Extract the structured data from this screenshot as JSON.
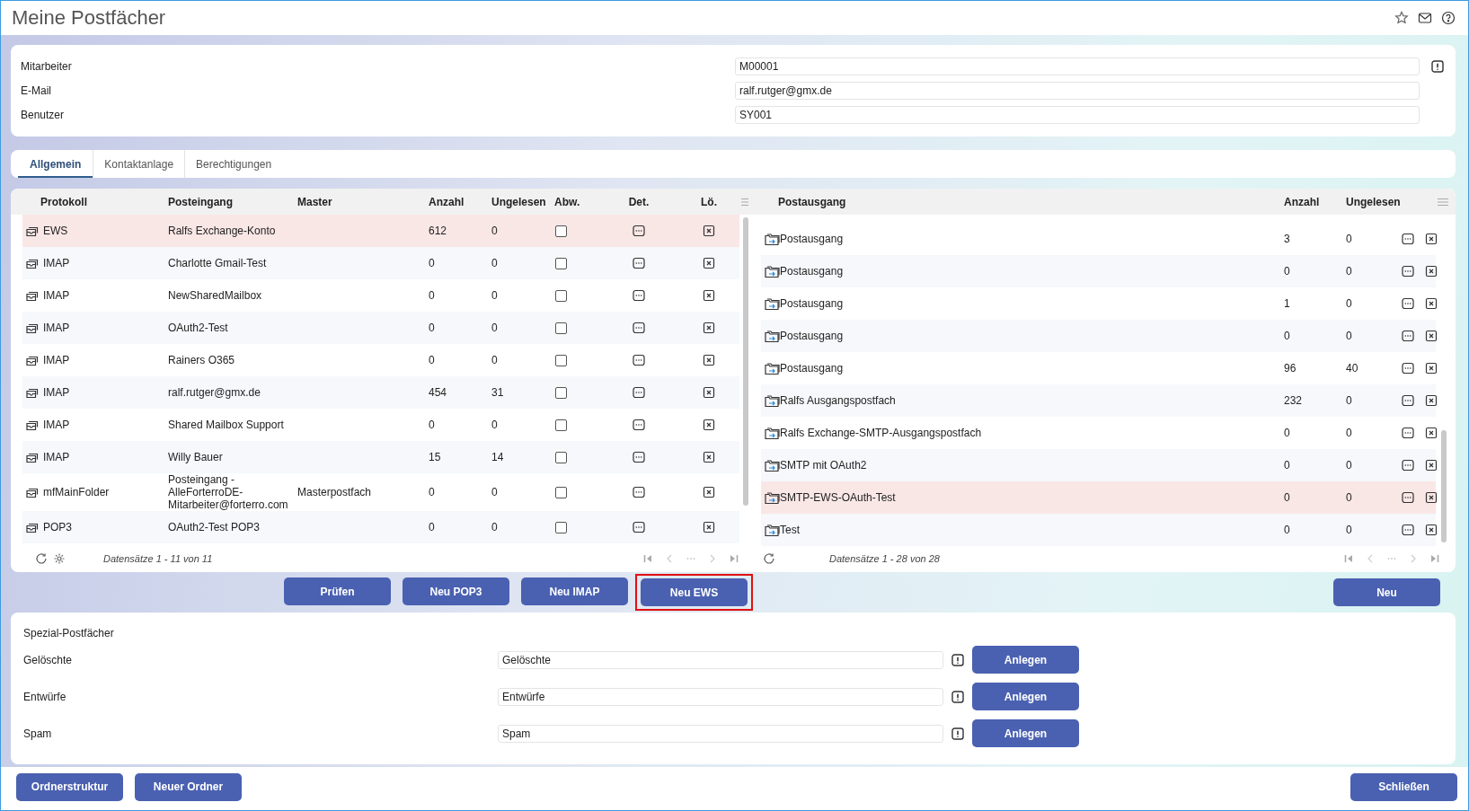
{
  "page": {
    "title": "Meine Postfächer"
  },
  "header_fields": [
    {
      "label": "Mitarbeiter",
      "value": "M00001",
      "alert": true
    },
    {
      "label": "E-Mail",
      "value": "ralf.rutger@gmx.de",
      "alert": false
    },
    {
      "label": "Benutzer",
      "value": "SY001",
      "alert": false
    }
  ],
  "tabs": [
    {
      "label": "Allgemein",
      "selected": true
    },
    {
      "label": "Kontaktanlage",
      "selected": false
    },
    {
      "label": "Berechtigungen",
      "selected": false
    }
  ],
  "inbox_table": {
    "columns": [
      "Protokoll",
      "Posteingang",
      "Master",
      "Anzahl",
      "Ungelesen",
      "Abw.",
      "Det.",
      "Lö."
    ],
    "rows": [
      {
        "protocol": "EWS",
        "name": "Ralfs Exchange-Konto",
        "count": "612",
        "unread": "0",
        "checked": false,
        "selected": true
      },
      {
        "protocol": "IMAP",
        "name": "Charlotte Gmail-Test",
        "count": "0",
        "unread": "0",
        "checked": false,
        "selected": false
      },
      {
        "protocol": "IMAP",
        "name": "NewSharedMailbox",
        "count": "0",
        "unread": "0",
        "checked": false,
        "selected": false
      },
      {
        "protocol": "IMAP",
        "name": "OAuth2-Test",
        "count": "0",
        "unread": "0",
        "checked": false,
        "selected": false
      },
      {
        "protocol": "IMAP",
        "name": "Rainers O365",
        "count": "0",
        "unread": "0",
        "checked": false,
        "selected": false
      },
      {
        "protocol": "IMAP",
        "name": "ralf.rutger@gmx.de",
        "count": "454",
        "unread": "31",
        "checked": false,
        "selected": false
      },
      {
        "protocol": "IMAP",
        "name": "Shared Mailbox Support",
        "count": "0",
        "unread": "0",
        "checked": false,
        "selected": false
      },
      {
        "protocol": "IMAP",
        "name": "Willy Bauer",
        "count": "15",
        "unread": "14",
        "checked": false,
        "selected": false
      },
      {
        "protocol": "mfMainFolder",
        "name": "Posteingang - AlleForterroDE-Mitarbeiter@forterro.com",
        "master": "Masterpostfach",
        "count": "0",
        "unread": "0",
        "checked": false,
        "selected": false
      },
      {
        "protocol": "POP3",
        "name": "OAuth2-Test POP3",
        "count": "0",
        "unread": "0",
        "checked": false,
        "selected": false
      }
    ],
    "footer": "Datensätze 1 - 11 von 11"
  },
  "outbox_table": {
    "columns": [
      "Postausgang",
      "Anzahl",
      "Ungelesen"
    ],
    "rows": [
      {
        "name": "Postausgang",
        "count": "3",
        "unread": "0",
        "selected": false
      },
      {
        "name": "Postausgang",
        "count": "0",
        "unread": "0",
        "selected": false
      },
      {
        "name": "Postausgang",
        "count": "1",
        "unread": "0",
        "selected": false
      },
      {
        "name": "Postausgang",
        "count": "0",
        "unread": "0",
        "selected": false
      },
      {
        "name": "Postausgang",
        "count": "96",
        "unread": "40",
        "selected": false
      },
      {
        "name": "Ralfs Ausgangspostfach",
        "count": "232",
        "unread": "0",
        "selected": false
      },
      {
        "name": "Ralfs Exchange-SMTP-Ausgangspostfach",
        "count": "0",
        "unread": "0",
        "selected": false
      },
      {
        "name": "SMTP mit OAuth2",
        "count": "0",
        "unread": "0",
        "selected": false
      },
      {
        "name": "SMTP-EWS-OAuth-Test",
        "count": "0",
        "unread": "0",
        "selected": true
      },
      {
        "name": "Test",
        "count": "0",
        "unread": "0",
        "selected": false
      }
    ],
    "footer": "Datensätze 1 - 28 von 28"
  },
  "inbox_buttons": [
    {
      "label": "Prüfen",
      "highlighted": false
    },
    {
      "label": "Neu POP3",
      "highlighted": false
    },
    {
      "label": "Neu IMAP",
      "highlighted": false
    },
    {
      "label": "Neu EWS",
      "highlighted": true
    }
  ],
  "outbox_buttons": [
    {
      "label": "Neu",
      "highlighted": false
    }
  ],
  "special": {
    "title": "Spezial-Postfächer",
    "rows": [
      {
        "label": "Gelöschte",
        "value": "Gelöschte",
        "alert": true,
        "button": "Anlegen"
      },
      {
        "label": "Entwürfe",
        "value": "Entwürfe",
        "alert": true,
        "button": "Anlegen"
      },
      {
        "label": "Spam",
        "value": "Spam",
        "alert": true,
        "button": "Anlegen"
      }
    ]
  },
  "footer_buttons": {
    "left": [
      "Ordnerstruktur",
      "Neuer Ordner"
    ],
    "right": [
      "Schließen"
    ]
  }
}
